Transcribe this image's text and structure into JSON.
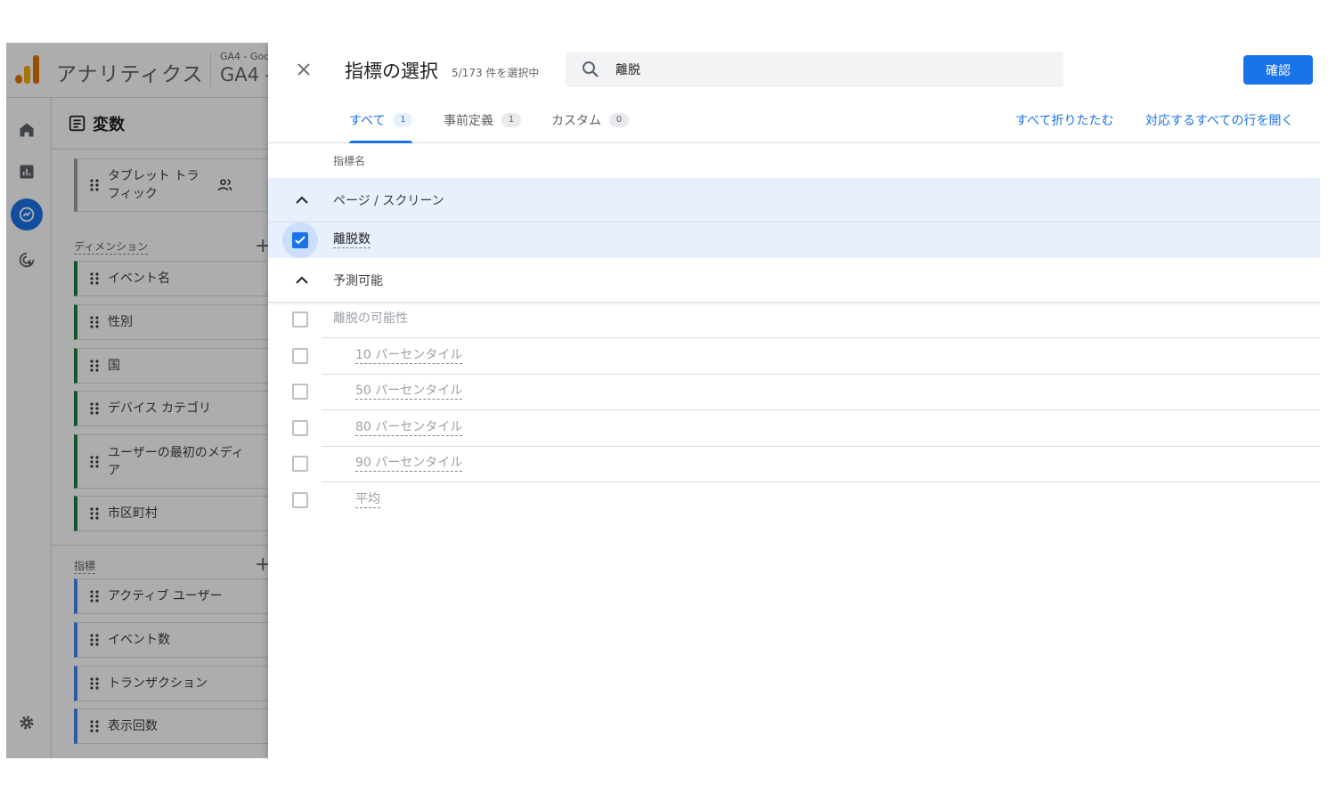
{
  "app": {
    "title": "アナリティクス",
    "account_line1": "GA4 - Goo",
    "account_line2": "GA4 -"
  },
  "rail": {
    "items": [
      {
        "icon": "home-icon"
      },
      {
        "icon": "reports-icon"
      },
      {
        "icon": "explore-icon",
        "active": true
      },
      {
        "icon": "advertising-icon"
      }
    ],
    "settings_icon": "gear-icon"
  },
  "variables": {
    "title": "変数",
    "segment": "タブレット トラ\nフィック",
    "dimensions_label": "ディメンション",
    "dimensions": [
      "イベント名",
      "性別",
      "国",
      "デバイス カテゴリ",
      "ユーザーの最初のメディ\nア",
      "市区町村"
    ],
    "metrics_label": "指標",
    "metrics": [
      "アクティブ ユーザー",
      "イベント数",
      "トランザクション",
      "表示回数"
    ]
  },
  "dialog": {
    "title": "指標の選択",
    "count": "5/173 件を選択中",
    "search_value": "離脱",
    "confirm_label": "確認",
    "tabs": [
      {
        "label": "すべて",
        "count": "1",
        "active": true
      },
      {
        "label": "事前定義",
        "count": "1"
      },
      {
        "label": "カスタム",
        "count": "0"
      }
    ],
    "collapse_all": "すべて折りたたむ",
    "expand_all": "対応するすべての行を開く",
    "column_header": "指標名",
    "groups": [
      {
        "label": "ページ / スクリーン",
        "items": [
          {
            "label": "離脱数",
            "checked": true
          }
        ]
      },
      {
        "label": "予測可能",
        "items": [
          {
            "label": "離脱の可能性",
            "checked": false
          },
          {
            "label": "10 パーセンタイル",
            "checked": false
          },
          {
            "label": "50 パーセンタイル",
            "checked": false
          },
          {
            "label": "80 パーセンタイル",
            "checked": false
          },
          {
            "label": "90 パーセンタイル",
            "checked": false
          },
          {
            "label": "平均",
            "checked": false
          }
        ]
      }
    ]
  },
  "colors": {
    "accent": "#1a73e8",
    "selected_row": "#e8f0fe",
    "dimension_bar": "#188038",
    "metric_bar": "#4285f4",
    "logo_orange": "#f9ab00",
    "logo_dark_orange": "#e37400"
  }
}
